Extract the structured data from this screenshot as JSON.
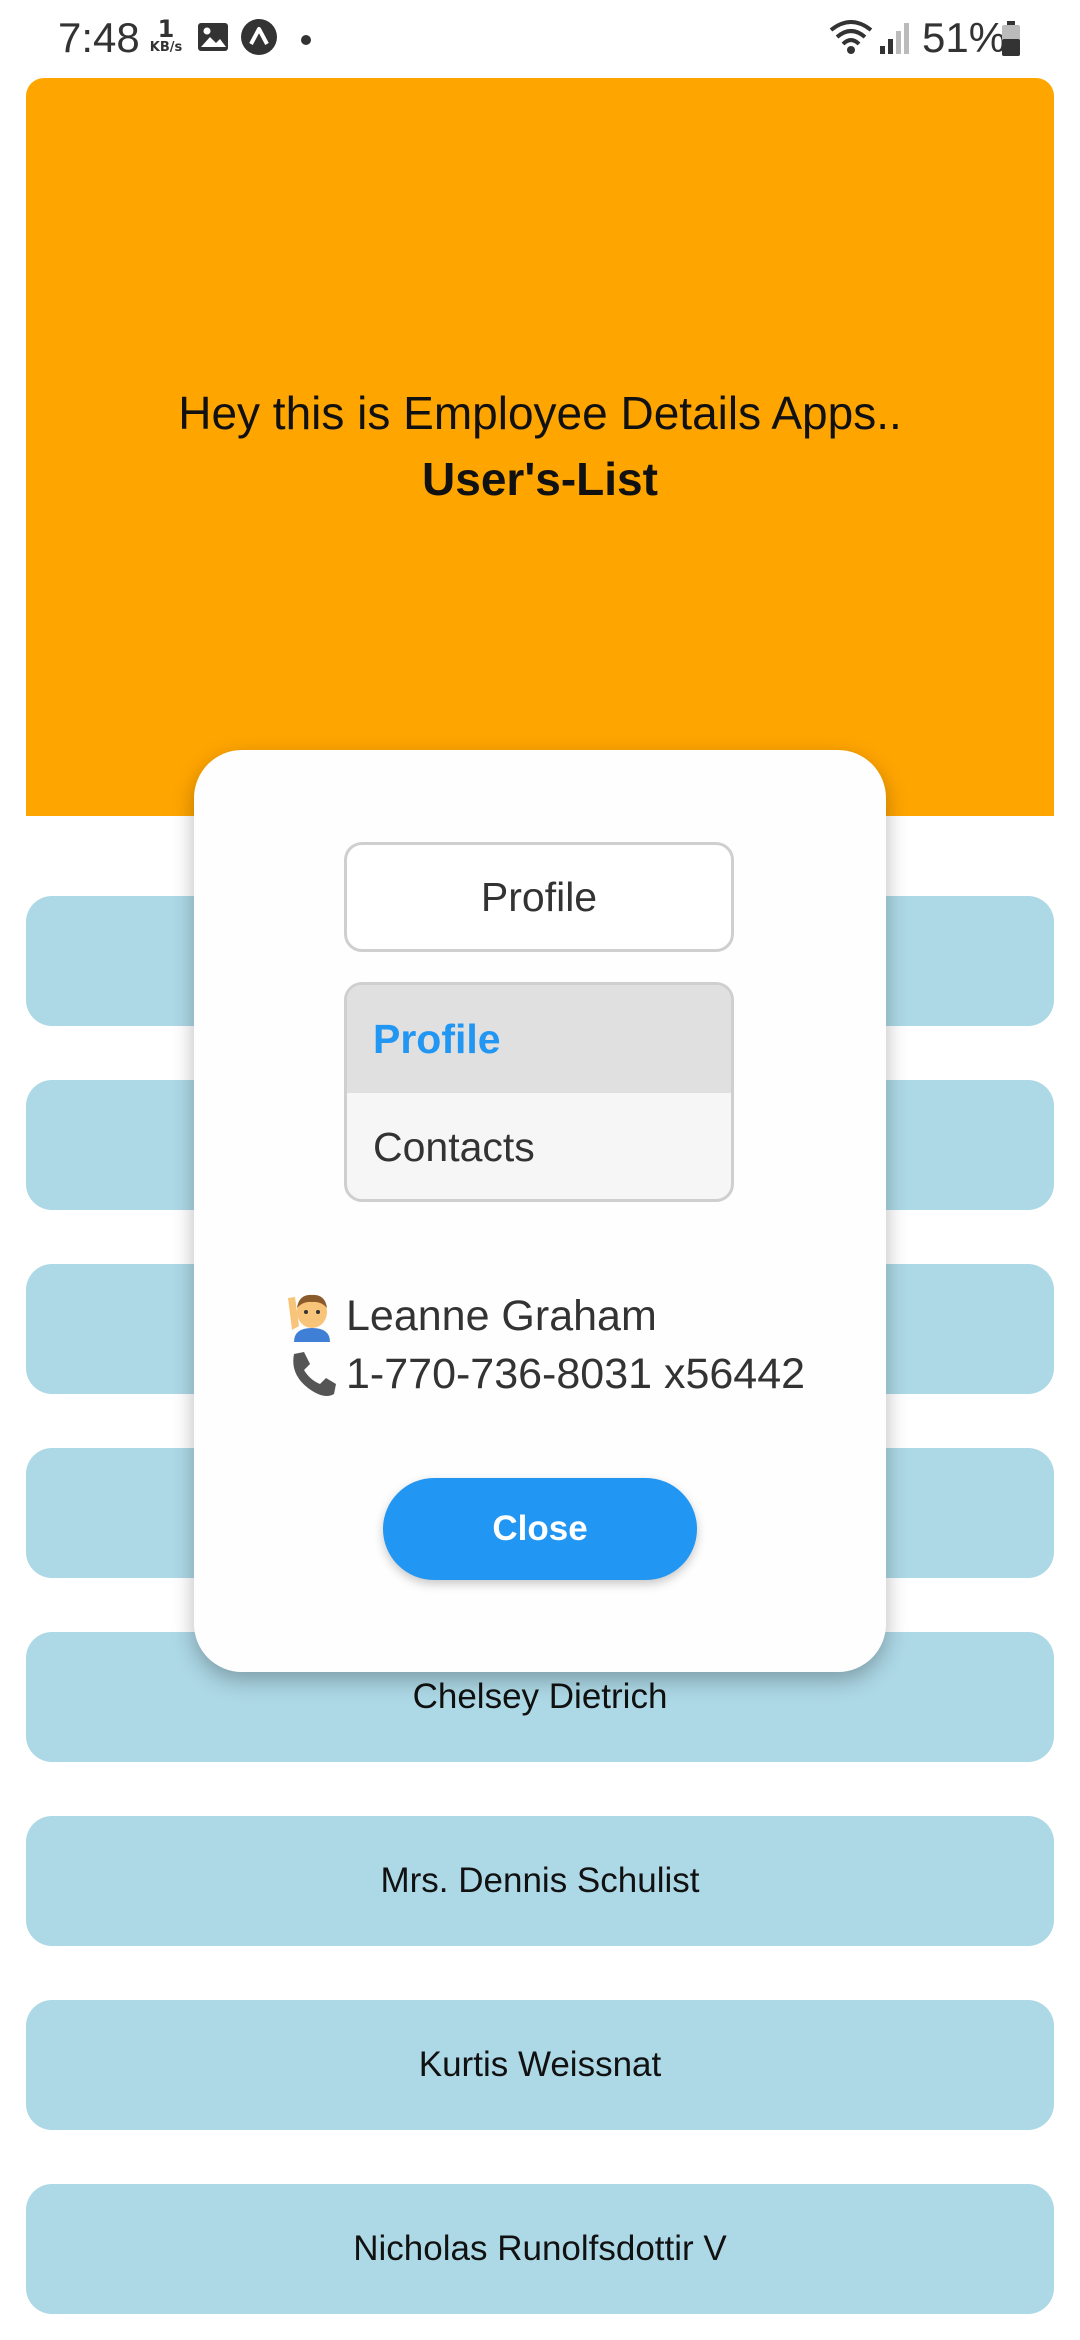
{
  "status_bar": {
    "time": "7:48",
    "net_speed_value": "1",
    "net_speed_unit": "KB/s",
    "battery": "51%"
  },
  "header": {
    "title": "Hey this is Employee Details Apps..",
    "subtitle": "User's-List"
  },
  "users": [
    "",
    "",
    "",
    "",
    "Chelsey Dietrich",
    "Mrs. Dennis Schulist",
    "Kurtis Weissnat",
    "Nicholas Runolfsdottir V"
  ],
  "modal": {
    "dropdown_selected": "Profile",
    "dropdown_options": [
      "Profile",
      "Contacts"
    ],
    "name": "Leanne Graham",
    "phone": "1-770-736-8031 x56442",
    "close_label": "Close"
  },
  "colors": {
    "header_bg": "#ffa500",
    "list_item_bg": "#add8e6",
    "accent": "#2196f3"
  }
}
